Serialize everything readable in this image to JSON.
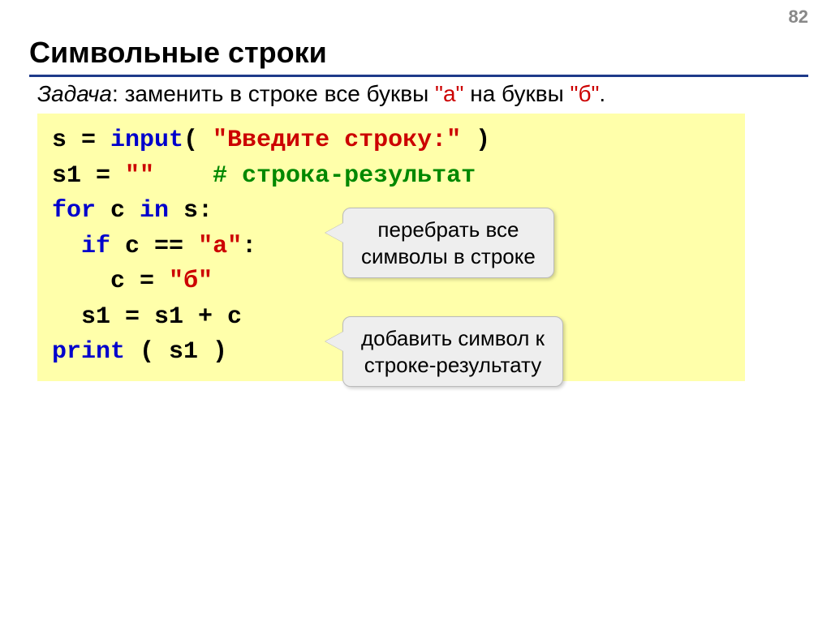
{
  "page_number": "82",
  "title": "Символьные строки",
  "task": {
    "label": "Задача",
    "sep": ": ",
    "text1": "заменить в строке все буквы ",
    "a_quoted": "\"а\"",
    "text2": " на буквы ",
    "b_quoted": "\"б\"",
    "dot": "."
  },
  "code": {
    "l1a": "s = ",
    "l1b": "input",
    "l1c": "( ",
    "l1d": "\"Введите строку:\"",
    "l1e": " )",
    "l2a": "s1 = ",
    "l2b": "\"\"",
    "l2c": "    ",
    "l2d": "# строка-результат",
    "l3a": "for",
    "l3b": " c ",
    "l3c": "in",
    "l3d": " s:",
    "l4a": "  ",
    "l4b": "if",
    "l4c": " c == ",
    "l4d": "\"а\"",
    "l4e": ":",
    "l5a": "    c = ",
    "l5b": "\"б\"",
    "l6": "  s1 = s1 + c",
    "l7a": "print",
    "l7b": " ( s1 )"
  },
  "callouts": {
    "c1_l1": "перебрать все",
    "c1_l2": "символы в строке",
    "c2_l1": "добавить символ к",
    "c2_l2": "строке-результату"
  }
}
